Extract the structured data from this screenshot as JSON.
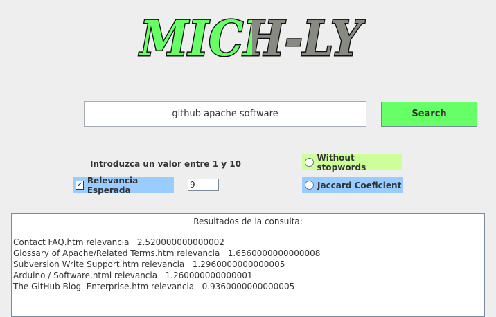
{
  "app": {
    "logo_text": "MICH-LY"
  },
  "search": {
    "query": "github apache software",
    "button_label": "Search"
  },
  "controls": {
    "prompt": "Introduzca un valor entre 1 y 10",
    "relevancia_label": "Relevancia Esperada",
    "relevancia_checked": true,
    "check_glyph": "✔",
    "value": "9",
    "stopwords_label": "Without stopwords",
    "jaccard_label": "Jaccard Coeficient"
  },
  "results": {
    "title": "Resultados de la consulta:",
    "lines": [
      "Contact FAQ.htm relevancia   2.520000000000002",
      "Glossary of Apache/Related Terms.htm relevancia   1.6560000000000008",
      "Subversion Write Support.htm relevancia   1.2960000000000005",
      "Arduino / Software.html relevancia   1.260000000000001",
      "The GitHub Blog  Enterprise.htm relevancia   0.9360000000000005"
    ]
  },
  "colors": {
    "logo_green": "#66ff66",
    "logo_grey": "#878a80",
    "search_button": "#66ff66",
    "relevancia_chip": "#99ccff",
    "stopwords_chip": "#ccff99",
    "jaccard_chip": "#99ccff"
  }
}
